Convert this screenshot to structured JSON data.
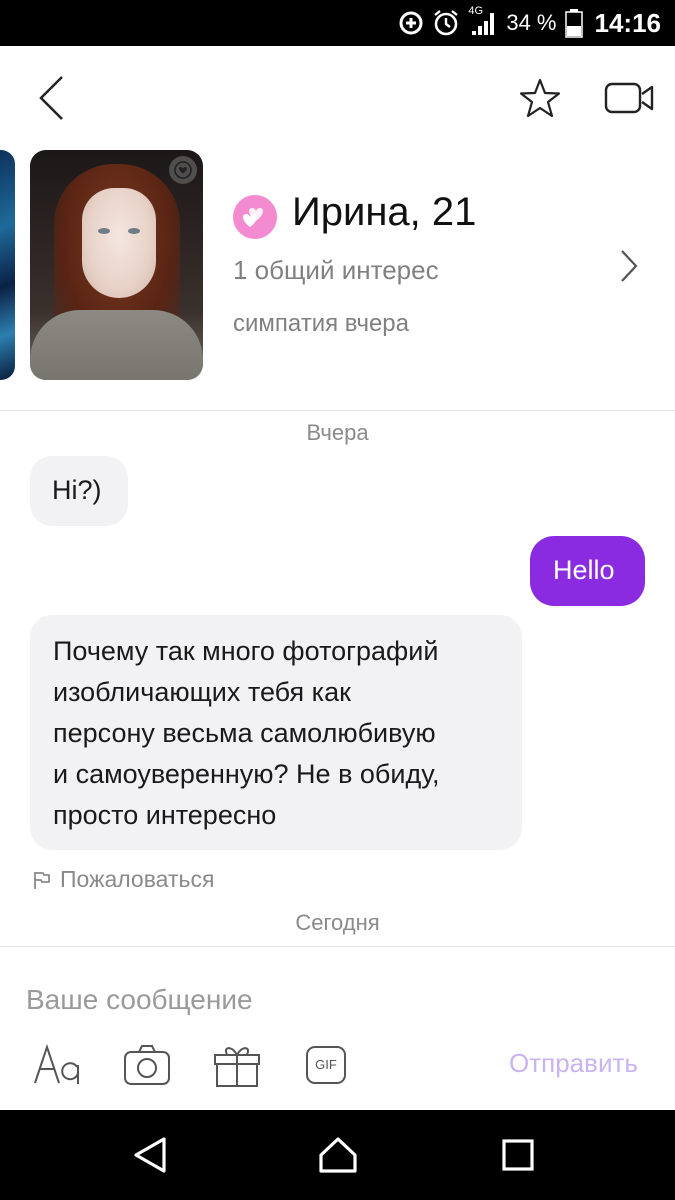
{
  "status_bar": {
    "network": "4G",
    "battery": "34 %",
    "time": "14:16",
    "icons": [
      "data-saver-icon",
      "alarm-icon",
      "signal-icon",
      "battery-icon"
    ]
  },
  "header": {
    "icons": [
      "back-arrow-icon",
      "star-icon",
      "video-camera-icon"
    ]
  },
  "profile": {
    "name": "Ирина, 21",
    "interest": "1 общий интерес",
    "sympathy": "симпатия вчера",
    "match_icon": "double-heart-icon",
    "accent_color": "#f48bd0"
  },
  "chat": {
    "date_yesterday": "Вчера",
    "messages": [
      {
        "direction": "in",
        "text": "Hi?)"
      },
      {
        "direction": "out",
        "text": "Hello"
      },
      {
        "direction": "in",
        "lines": [
          "Почему так много фотографий",
          "изобличающих тебя как",
          "персону весьма самолюбивую",
          "и самоуверенную? Не в обиду,",
          "просто интересно"
        ]
      }
    ],
    "report_label": "Пожаловаться",
    "date_today": "Сегодня",
    "outgoing_color": "#8a2be2"
  },
  "composer": {
    "placeholder": "Ваше сообщение",
    "tools": [
      "font-icon",
      "camera-icon",
      "gift-icon",
      "gif-icon"
    ],
    "gif_label": "GIF",
    "send_label": "Отправить"
  },
  "nav_bar": {
    "icons": [
      "nav-back-icon",
      "nav-home-icon",
      "nav-recents-icon"
    ]
  }
}
